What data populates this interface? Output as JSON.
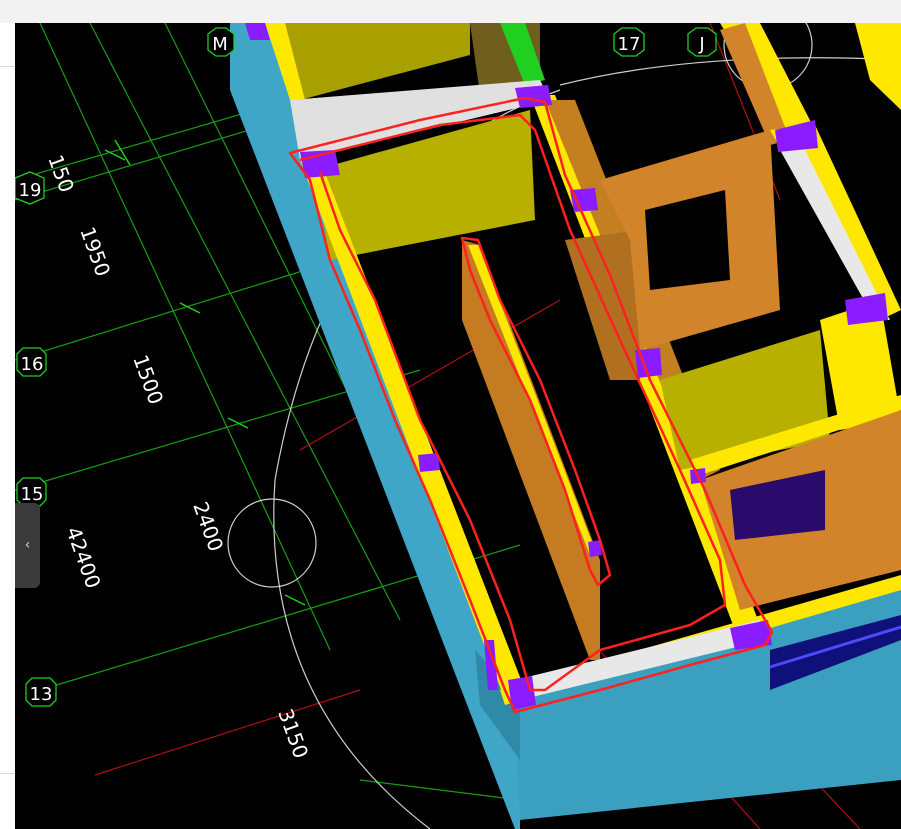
{
  "axis_bubbles": {
    "m": "M",
    "n17": "17",
    "j": "J",
    "n19": "19",
    "n16": "16",
    "n15": "15",
    "n13": "13"
  },
  "dimensions": {
    "d150": "150",
    "d1950": "1950",
    "d1500": "1500",
    "d2400": "2400",
    "d42400": "42400",
    "d3150": "3150"
  },
  "ui": {
    "collapse_glyph": "‹"
  },
  "colors": {
    "background": "#000000",
    "grid": "#14a014",
    "axis_red": "#b01010",
    "wall_cyan": "#3fa6c8",
    "wall_yellow": "#a8a000",
    "beam_yellow": "#ffe800",
    "wall_orange": "#d2842a",
    "column_purple": "#8a1cff",
    "markup_red": "#ff2020"
  }
}
